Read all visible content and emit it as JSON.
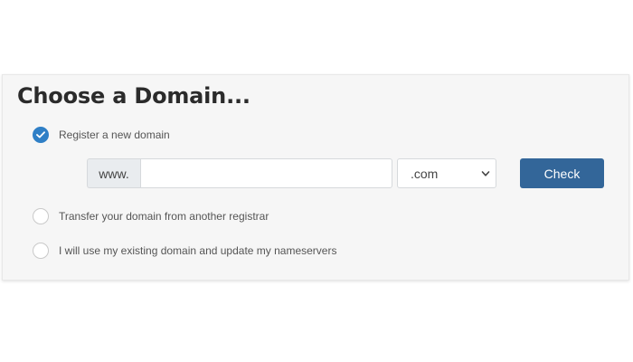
{
  "panel": {
    "title": "Choose a Domain..."
  },
  "options": [
    {
      "label": "Register a new domain",
      "checked": true
    },
    {
      "label": "Transfer your domain from another registrar",
      "checked": false
    },
    {
      "label": "I will use my existing domain and update my nameservers",
      "checked": false
    }
  ],
  "domain_search": {
    "prefix": "www.",
    "input_value": "",
    "input_placeholder": "",
    "tld_selected": ".com",
    "button_label": "Check"
  },
  "icons": {
    "checkmark": "check-icon",
    "dropdown": "chevron-down-icon"
  },
  "colors": {
    "accent": "#2f7fc6",
    "button": "#336699",
    "panel_background": "#f6f6f6"
  }
}
